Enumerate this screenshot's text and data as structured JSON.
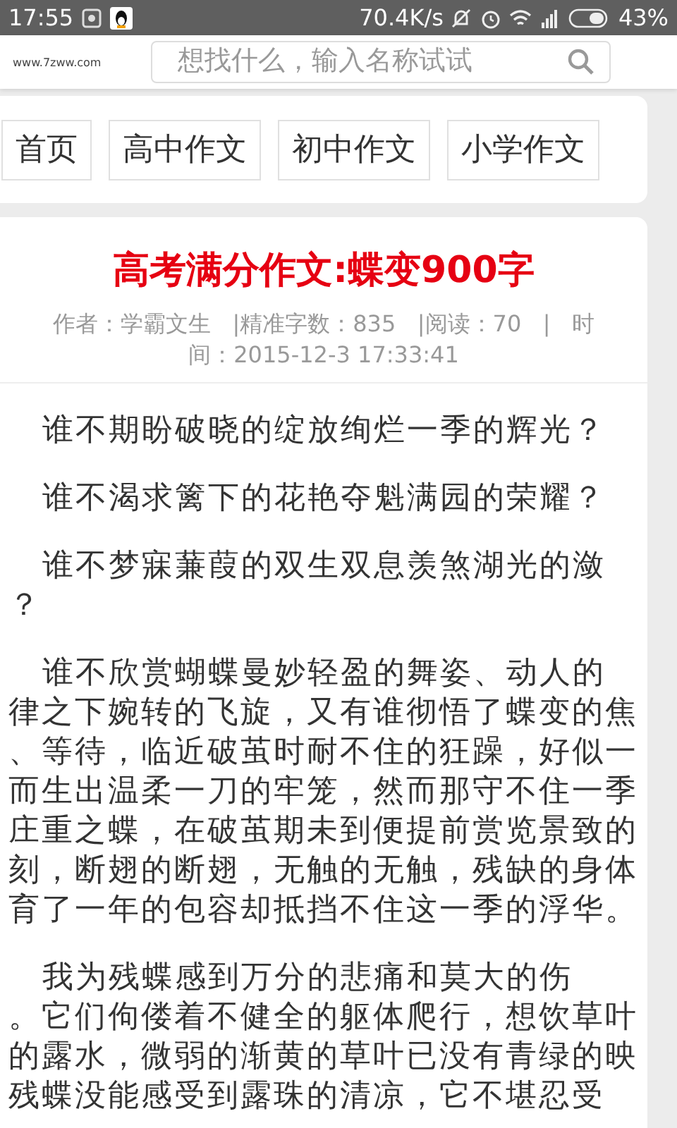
{
  "status_bar": {
    "time": "17:55",
    "speed": "70.4K/s",
    "battery": "43%"
  },
  "header": {
    "site_url": "www.7zww.com",
    "search": {
      "placeholder": "想找什么，输入名称试试"
    }
  },
  "nav": {
    "items": [
      {
        "label": "首页"
      },
      {
        "label": "高中作文"
      },
      {
        "label": "初中作文"
      },
      {
        "label": "小学作文"
      }
    ]
  },
  "article": {
    "title": "高考满分作文:蝶变900字",
    "meta": [
      "作者：学霸文生   |精准字数：835   |阅读：70   |   时",
      "间：2015-12-3 17:33:41"
    ],
    "paragraphs": [
      {
        "lines": [
          "谁不期盼破晓的绽放绚烂一季的辉光？"
        ]
      },
      {
        "lines": [
          "谁不渴求篱下的花艳夺魁满园的荣耀？"
        ]
      },
      {
        "lines": [
          "谁不梦寐蒹葭的双生双息羡煞湖光的潋",
          "？"
        ]
      },
      {
        "lines": [
          "谁不欣赏蝴蝶曼妙轻盈的舞姿、动人的",
          "律之下婉转的飞旋，又有谁彻悟了蝶变的焦",
          "、等待，临近破茧时耐不住的狂躁，好似一",
          "而生出温柔一刀的牢笼，然而那守不住一季",
          "庄重之蝶，在破茧期未到便提前赏览景致的",
          "刻，断翅的断翅，无触的无触，残缺的身体",
          "育了一年的包容却抵挡不住这一季的浮华。"
        ]
      },
      {
        "lines": [
          "我为残蝶感到万分的悲痛和莫大的伤",
          "。它们佝偻着不健全的躯体爬行，想饮草叶",
          "的露水，微弱的渐黄的草叶已没有青绿的映",
          "残蝶没能感受到露珠的清凉，它不堪忍受"
        ]
      }
    ]
  }
}
